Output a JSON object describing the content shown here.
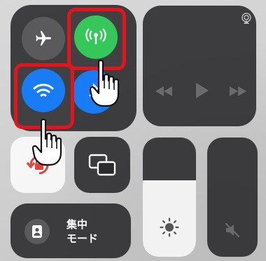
{
  "connectivity": {
    "airplane_icon": "airplane-icon",
    "cellular_icon": "cellular-antenna-icon",
    "wifi_icon": "wifi-icon",
    "bluetooth_icon": "bluetooth-icon",
    "colors": {
      "cellular_on": "#35c759",
      "wifi_on": "#1a7cf5",
      "bluetooth_on": "#1a7cf5",
      "off": "#5a5a5d",
      "highlight": "#e3141b"
    }
  },
  "media": {
    "airplay_icon": "airplay-icon",
    "rewind_icon": "rewind-icon",
    "play_icon": "play-icon",
    "forward_icon": "fast-forward-icon"
  },
  "controls": {
    "rotation_lock_icon": "rotation-lock-icon",
    "mirroring_icon": "screen-mirroring-icon"
  },
  "focus": {
    "label_line1": "集中",
    "label_line2": "モード",
    "icon": "focus-person-icon"
  },
  "brightness": {
    "level": 0.64,
    "icon": "sun-icon"
  },
  "volume": {
    "level": 0.0,
    "icon": "speaker-muted-icon"
  },
  "annotations": {
    "pointer": "hand-pointer-icon"
  }
}
